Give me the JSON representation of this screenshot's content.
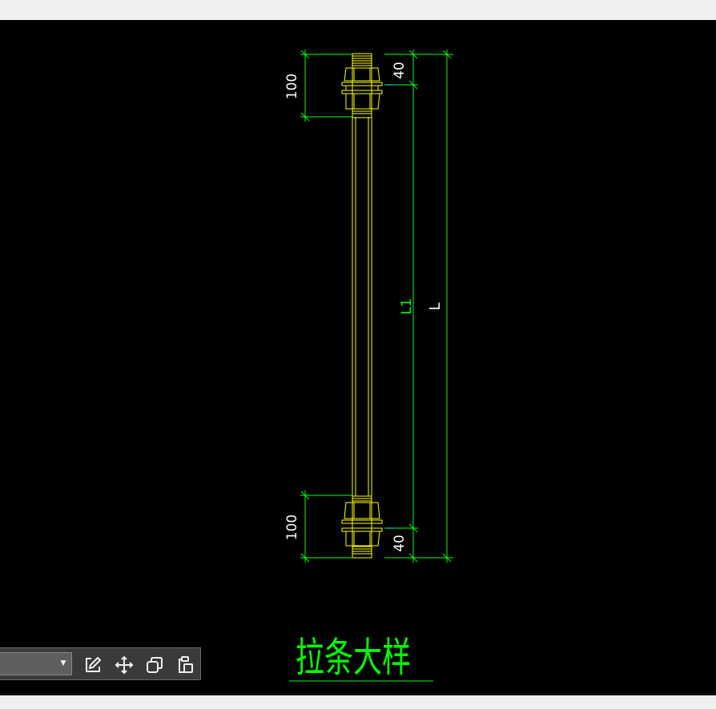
{
  "drawing": {
    "title": "拉条大样",
    "dim_top_left": "100",
    "dim_top_right": "40",
    "dim_bottom_left": "100",
    "dim_bottom_right": "40",
    "dim_l1": "L1",
    "dim_l": "L"
  },
  "toolbar": {
    "layer_value": "",
    "tools": [
      "edit-icon",
      "move-icon",
      "copy-icon",
      "paste-icon"
    ]
  },
  "colors": {
    "background": "#000000",
    "bolt": "#ffff00",
    "dimension": "#00ff00",
    "accent": "#00ffff",
    "dim_text": "#ffffff"
  }
}
